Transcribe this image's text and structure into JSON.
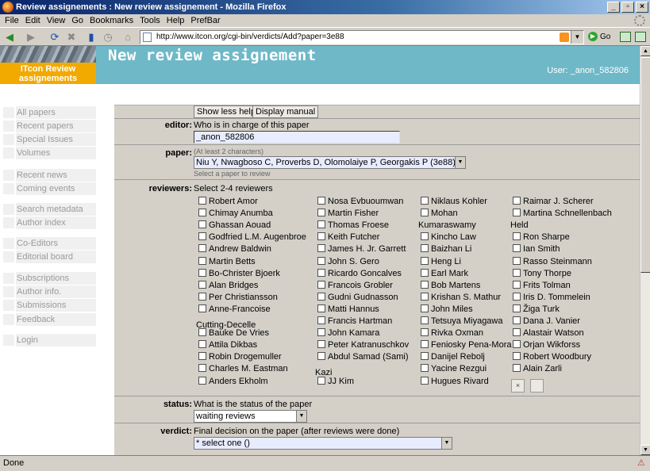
{
  "window": {
    "title": "Review assignements : New review assignement - Mozilla Firefox",
    "buttons": [
      "_",
      "▫",
      "×"
    ]
  },
  "menu": [
    "File",
    "Edit",
    "View",
    "Go",
    "Bookmarks",
    "Tools",
    "Help",
    "PrefBar"
  ],
  "nav": {
    "url": "http://www.itcon.org/cgi-bin/verdicts/Add?paper=3e88",
    "go_label": "Go"
  },
  "status_text": "Done",
  "header": {
    "logo_title": "ITcon Review assignements",
    "page_title": "New review assignement",
    "user": "User: _anon_582806"
  },
  "sidebar": [
    "All papers",
    "Recent papers",
    "Special Issues",
    "Volumes",
    "Recent news",
    "Coming events",
    "Search metadata",
    "Author index",
    "Co-Editors",
    "Editorial board",
    "Subscriptions",
    "Author info.",
    "Submissions",
    "Feedback",
    "Login"
  ],
  "form": {
    "buttons": {
      "show_less_help": "Show less help",
      "display_manual": "Display manual"
    },
    "editor": {
      "label": "editor:",
      "help": "Who is in charge of this paper",
      "value": "_anon_582806"
    },
    "paper": {
      "label": "paper:",
      "hint_top": "(At least 2 characters)",
      "value": "Niu Y, Nwagboso C, Proverbs D, Olomolaiye P, Georgakis P (3e88)",
      "hint_bottom": "Select a paper to review"
    },
    "reviewers": {
      "label": "reviewers:",
      "help": "Select 2-4 reviewers",
      "col1": [
        "Robert Amor",
        "Chimay Anumba",
        "Ghassan Aouad",
        "Godfried L.M. Augenbroe",
        "Andrew Baldwin",
        "Martin Betts",
        "Bo-Christer Bjoerk",
        "Alan Bridges",
        "Per Christiansson",
        "Anne-Francoise",
        "Bauke De Vries",
        "Attila Dikbas",
        "Robin Drogemuller",
        "Charles M. Eastman",
        "Anders Ekholm"
      ],
      "col1_cont": "Cutting-Decelle",
      "col2": [
        "Nosa Evbuoumwan",
        "Martin Fisher",
        "Thomas Froese",
        "Keith Futcher",
        "James H. Jr. Garrett",
        "John S. Gero",
        "Ricardo Goncalves",
        "Francois Grobler",
        "Gudni Gudnasson",
        "Matti Hannus",
        "Francis Hartman",
        "John Kamara",
        "Peter Katranuschkov",
        "Abdul Samad (Sami)",
        "JJ Kim"
      ],
      "col2_cont": "Kazi",
      "col3": [
        "Niklaus Kohler",
        "Mohan",
        "Kincho Law",
        "Baizhan Li",
        "Heng Li",
        "Earl Mark",
        "Bob Martens",
        "Krishan S. Mathur",
        "John Miles",
        "Tetsuya Miyagawa",
        "Rivka Oxman",
        "Feniosky Pena-Mora",
        "Danijel Rebolj",
        "Yacine Rezgui",
        "Hugues Rivard"
      ],
      "col3_cont": "Kumaraswamy",
      "col4": [
        "Raimar J. Scherer",
        "Martina Schnellenbach",
        "Ron Sharpe",
        "Ian Smith",
        "Rasso Steinmann",
        "Tony Thorpe",
        "Frits Tolman",
        "Iris D. Tommelein",
        "Žiga Turk",
        "Dana J. Vanier",
        "Alastair Watson",
        "Orjan Wikforss",
        "Robert Woodbury",
        "Alain Zarli"
      ],
      "col4_cont": "Held",
      "clear_button": "×"
    },
    "status": {
      "label": "status:",
      "help": "What is the status of the paper",
      "value": "waiting reviews"
    },
    "verdict": {
      "label": "verdict:",
      "help": "Final decision on the paper (after reviews were done)",
      "value": "* select one ()"
    }
  }
}
